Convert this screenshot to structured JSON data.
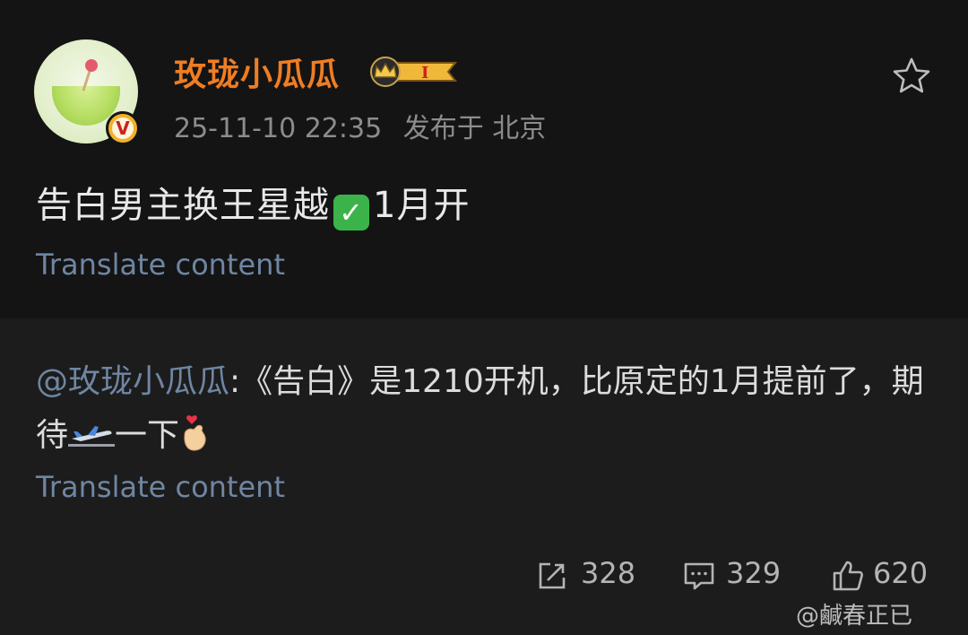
{
  "post": {
    "username": "玫珑小瓜瓜",
    "verified_badge": "V",
    "level_badge": "I",
    "timestamp": "25-11-10 22:35",
    "location": "发布于 北京",
    "text_before": "告白男主换王星越",
    "text_after": "1月开",
    "translate_label": "Translate content"
  },
  "repost": {
    "mention": "@玫珑小瓜瓜",
    "text": ":《告白》是1210开机，比原定的1月提前了，期待",
    "text_end": "一下",
    "translate_label": "Translate content"
  },
  "stats": {
    "reposts": "328",
    "comments": "329",
    "likes": "620"
  },
  "watermark": "@鹹春正已",
  "colors": {
    "background": "#141414",
    "repost_background": "#1c1c1c",
    "username": "#ef7d22",
    "link": "#6f86a3"
  },
  "icons": [
    "star-icon",
    "repost-icon",
    "comment-icon",
    "like-icon",
    "crown-badge-icon",
    "verified-icon"
  ]
}
